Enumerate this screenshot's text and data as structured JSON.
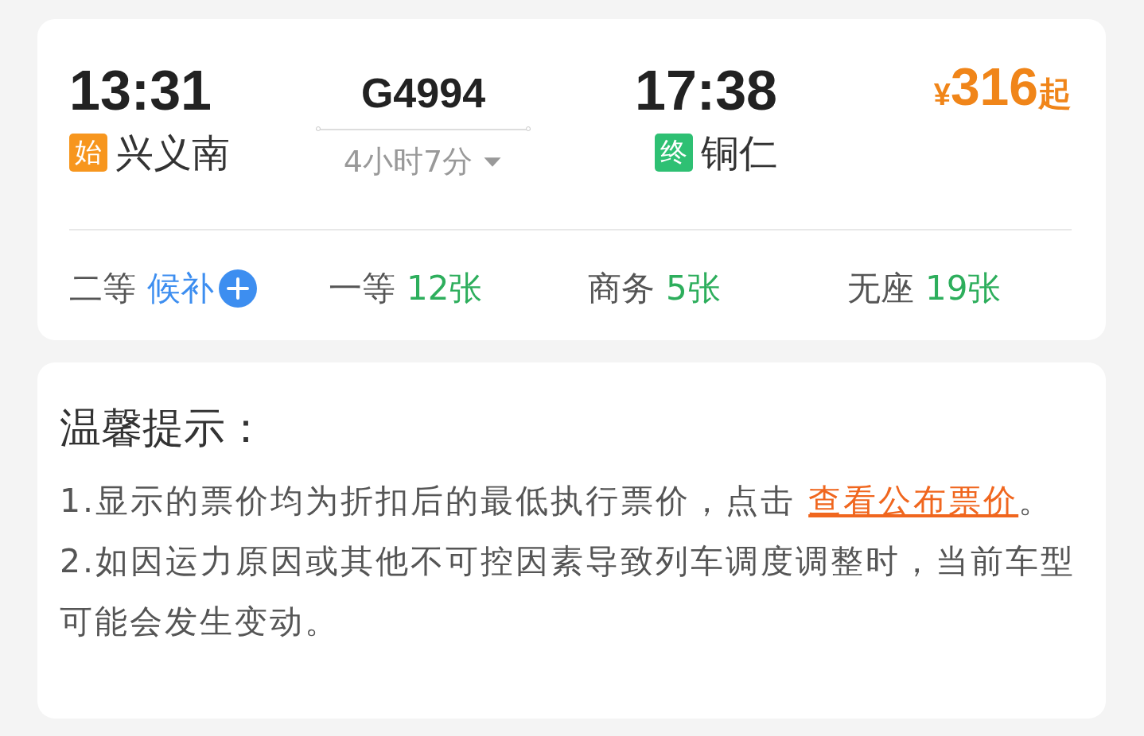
{
  "train_card": {
    "departure": {
      "time": "13:31",
      "badge": "始",
      "station": "兴义南",
      "kind": "origin"
    },
    "train": {
      "number": "G4994",
      "duration": "4小时7分"
    },
    "arrival": {
      "time": "17:38",
      "badge": "终",
      "station": "铜仁",
      "kind": "terminal"
    },
    "price": {
      "currency": "¥",
      "amount": "316",
      "suffix": "起"
    },
    "seats": [
      {
        "class": "二等",
        "availability": "候补",
        "kind": "waitlist"
      },
      {
        "class": "一等",
        "availability": "12张",
        "kind": "count"
      },
      {
        "class": "商务",
        "availability": "5张",
        "kind": "count"
      },
      {
        "class": "无座",
        "availability": "19张",
        "kind": "count"
      }
    ]
  },
  "notice": {
    "title": "温馨提示：",
    "items": [
      {
        "text": "1.显示的票价均为折扣后的最低执行票价，点击 ",
        "link": "查看公布票价",
        "after": "。"
      },
      {
        "text": "2.如因运力原因或其他不可控因素导致列车调度调整时，当前车型可能会发生变动。"
      }
    ]
  }
}
